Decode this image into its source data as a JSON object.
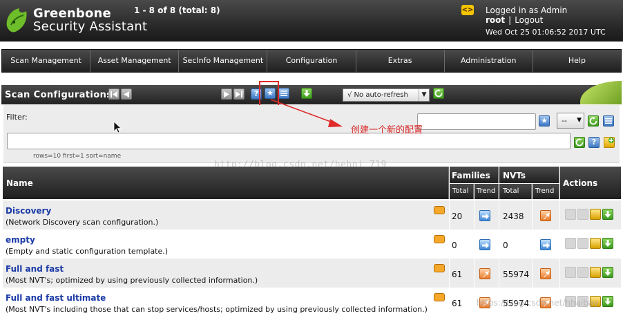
{
  "header": {
    "brand_line1": "Greenbone",
    "brand_line2": "Security Assistant",
    "notification_glyph": "<>",
    "logged_in_prefix": "Logged in as Admin",
    "user": "root",
    "separator": "|",
    "logout": "Logout",
    "datetime": "Wed Oct 25 01:06:52 2017 UTC"
  },
  "nav": {
    "items": [
      "Scan Management",
      "Asset Management",
      "SecInfo Management",
      "Configuration",
      "Extras",
      "Administration",
      "Help"
    ]
  },
  "section": {
    "title": "Scan Configurations",
    "page_info": "1 - 8 of 8 (total: 8)",
    "help_glyph": "?",
    "new_glyph": "★",
    "refresh_option": "√ No auto-refresh",
    "icons": [
      "first-page-icon",
      "previous-page-icon",
      "next-page-icon",
      "last-page-icon",
      "help-icon",
      "new-config-icon",
      "list-icon",
      "import-icon",
      "refresh-icon"
    ]
  },
  "filter": {
    "label": "Filter:",
    "top_value": "",
    "value": "",
    "dropdown_value": "--",
    "hint": "rows=10 first=1 sort=name"
  },
  "annotation": {
    "text": "创建一个新的配置",
    "watermark": "http://blog.csdn.net/hehni_719",
    "watermark2": "https://blog.csdn.net/hhaibay"
  },
  "table": {
    "headers": {
      "name": "Name",
      "families": "Families",
      "nvts": "NVTs",
      "actions": "Actions",
      "total": "Total",
      "trend": "Trend"
    },
    "rows": [
      {
        "name": "Discovery",
        "desc": "(Network Discovery scan configuration.)",
        "families": "20",
        "fam_trend": "right",
        "nvts": "2438",
        "nvt_trend": "up"
      },
      {
        "name": "empty",
        "desc": "(Empty and static configuration template.)",
        "families": "0",
        "fam_trend": "right",
        "nvts": "0",
        "nvt_trend": "right"
      },
      {
        "name": "Full and fast",
        "desc": "(Most NVT's; optimized by using previously collected information.)",
        "families": "61",
        "fam_trend": "up",
        "nvts": "55974",
        "nvt_trend": "up"
      },
      {
        "name": "Full and fast ultimate",
        "desc": "(Most NVT's including those that can stop services/hosts; optimized by using previously collected information.)",
        "families": "61",
        "fam_trend": "up",
        "nvts": "55974",
        "nvt_trend": "up"
      }
    ]
  },
  "colors": {
    "accent_green": "#6fa023",
    "link_blue": "#1a3aa6",
    "annotation_red": "#d82323"
  }
}
